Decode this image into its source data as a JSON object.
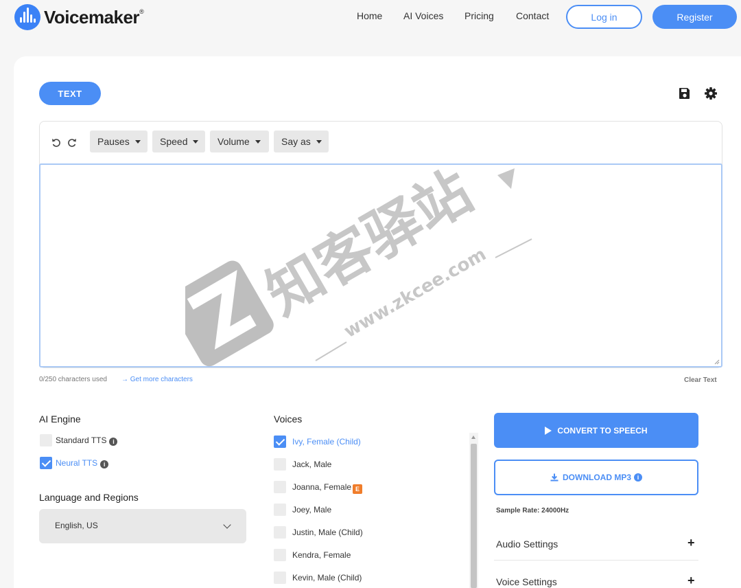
{
  "header": {
    "brand": "Voicemaker",
    "brand_mark": "®",
    "nav": [
      "Home",
      "AI Voices",
      "Pricing",
      "Contact"
    ],
    "login": "Log in",
    "register": "Register"
  },
  "editor": {
    "tab": "TEXT",
    "toolbar": [
      "Pauses",
      "Speed",
      "Volume",
      "Say as"
    ],
    "text": "",
    "char_count": "0/250 characters used",
    "more_chars": "→ Get more characters",
    "clear": "Clear Text"
  },
  "engine": {
    "title": "AI Engine",
    "options": [
      {
        "label": "Standard TTS",
        "checked": false
      },
      {
        "label": "Neural TTS",
        "checked": true
      }
    ]
  },
  "language": {
    "title": "Language and Regions",
    "selected": "English, US"
  },
  "voices": {
    "title": "Voices",
    "items": [
      {
        "label": "Ivy, Female (Child)",
        "checked": true
      },
      {
        "label": "Jack, Male",
        "checked": false
      },
      {
        "label": "Joanna, Female",
        "checked": false,
        "badge": "E"
      },
      {
        "label": "Joey, Male",
        "checked": false
      },
      {
        "label": "Justin, Male (Child)",
        "checked": false
      },
      {
        "label": "Kendra, Female",
        "checked": false
      },
      {
        "label": "Kevin, Male (Child)",
        "checked": false
      }
    ]
  },
  "actions": {
    "convert": "CONVERT TO SPEECH",
    "download": "DOWNLOAD MP3",
    "sample_rate": "Sample Rate: 24000Hz",
    "accordions": [
      "Audio Settings",
      "Voice Settings"
    ],
    "accordion_icon": "+"
  },
  "watermark": {
    "cn": "知客驿站",
    "url": "www.zkcee.com"
  },
  "colors": {
    "accent": "#4b8ef5",
    "badge": "#f07d2b"
  },
  "icons": [
    "save-icon",
    "gear-icon",
    "undo-icon",
    "redo-icon",
    "info-icon",
    "play-icon",
    "download-icon",
    "chevron-down-icon"
  ]
}
